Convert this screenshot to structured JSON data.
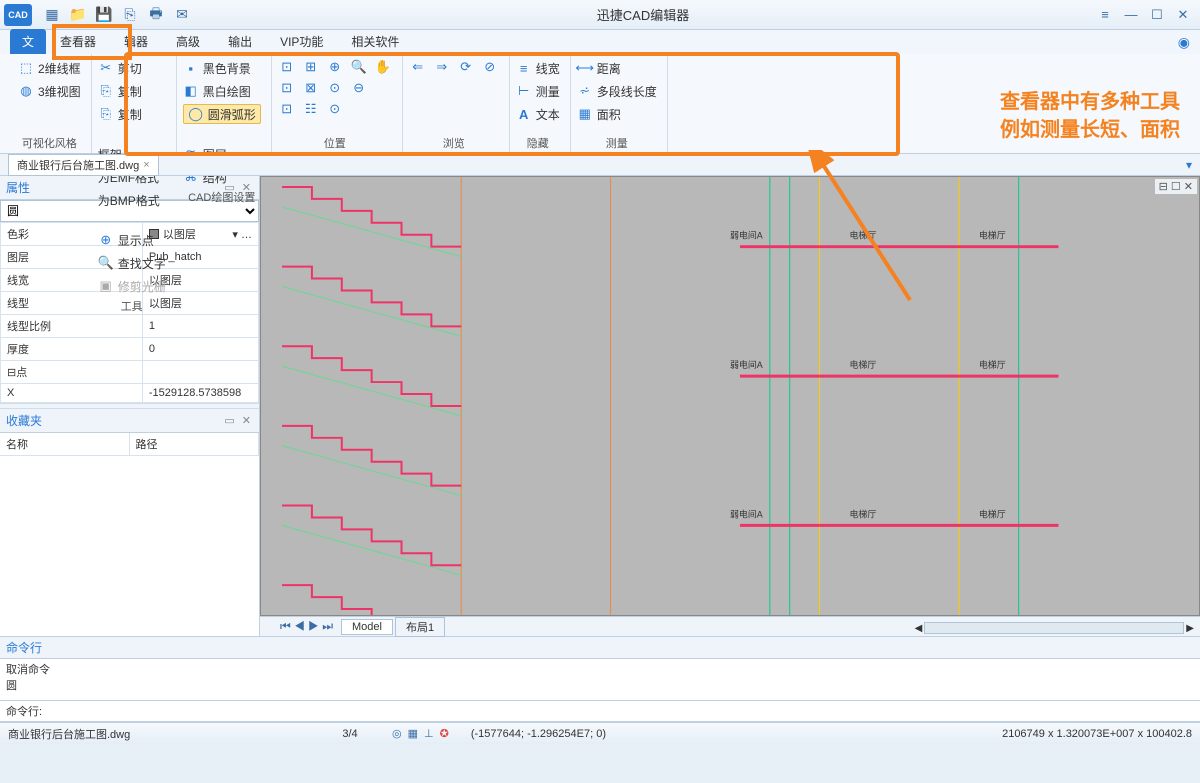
{
  "app": {
    "icon_text": "CAD",
    "title": "迅捷CAD编辑器"
  },
  "menu": {
    "file": "文",
    "tabs": [
      "查看器",
      "辑器",
      "高级",
      "输出",
      "VIP功能",
      "相关软件"
    ]
  },
  "ribbon": {
    "group_view": {
      "item1": "2维线框",
      "item2": "3维视图",
      "label": "可视化风格"
    },
    "group_tools": {
      "c1r1": "剪切",
      "c1r2": "复制",
      "c1r3": "复制",
      "c2r1": "框架",
      "c2r2": "为EMF格式",
      "c2r3": "为BMP格式",
      "c3r1": "显示点",
      "c3r2": "查找文字",
      "c3r3": "修剪光栅",
      "label": "工具"
    },
    "group_cad": {
      "c1r1": "黑色背景",
      "c1r2": "黑白绘图",
      "c1r3": "圆滑弧形",
      "c2r1": "图层",
      "c2r2": "结构",
      "label": "CAD绘图设置"
    },
    "group_pos": {
      "label": "位置"
    },
    "group_browse": {
      "label": "浏览"
    },
    "group_hide": {
      "r1": "线宽",
      "r2": "测量",
      "r3": "文本",
      "label": "隐藏"
    },
    "group_measure": {
      "r1": "距离",
      "r2": "多段线长度",
      "r3": "面积",
      "label": "测量"
    }
  },
  "annotation": {
    "line1": "查看器中有多种工具",
    "line2": "例如测量长短、面积"
  },
  "doc_tab": "商业银行后台施工图.dwg",
  "props": {
    "title": "属性",
    "select_val": "圆",
    "rows": [
      {
        "k": "色彩",
        "v": "以图层",
        "swatch": true,
        "dd": true
      },
      {
        "k": "图层",
        "v": "Pub_hatch"
      },
      {
        "k": "线宽",
        "v": "以图层"
      },
      {
        "k": "线型",
        "v": "以图层"
      },
      {
        "k": "线型比例",
        "v": "1"
      },
      {
        "k": "厚度",
        "v": "0"
      },
      {
        "k": "⊟点",
        "v": ""
      },
      {
        "k": "        X",
        "v": "-1529128.5738598"
      }
    ]
  },
  "fav": {
    "title": "收藏夹",
    "col1": "名称",
    "col2": "路径"
  },
  "canvas": {
    "tab1": "Model",
    "tab2": "布局1",
    "labels": {
      "ruodianA": "弱电间A",
      "dianti": "电梯厅"
    }
  },
  "cmd": {
    "title": "命令行",
    "out1": "取消命令",
    "out2": "圆",
    "label": "命令行:"
  },
  "status": {
    "file": "商业银行后台施工图.dwg",
    "page": "3/4",
    "coords": "(-1577644; -1.296254E7; 0)",
    "info": "2106749 x 1.320073E+007 x 100402.8"
  }
}
